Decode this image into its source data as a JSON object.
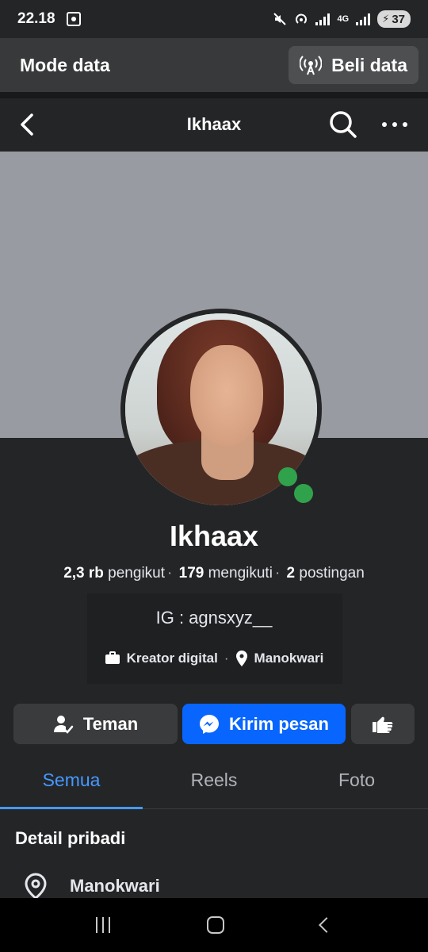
{
  "status_bar": {
    "time": "22.18",
    "network": "4G",
    "battery": "37"
  },
  "data_banner": {
    "title": "Mode data",
    "buy_label": "Beli data"
  },
  "header": {
    "title": "Ikhaax"
  },
  "profile": {
    "name": "Ikhaax",
    "followers_count": "2,3 rb",
    "followers_label": "pengikut",
    "following_count": "179",
    "following_label": "mengikuti",
    "posts_count": "2",
    "posts_label": "postingan",
    "bio": "IG : agnsxyz__",
    "category": "Kreator digital",
    "location": "Manokwari",
    "online": true
  },
  "actions": {
    "friend_label": "Teman",
    "message_label": "Kirim pesan"
  },
  "tabs": [
    {
      "label": "Semua",
      "active": true
    },
    {
      "label": "Reels",
      "active": false
    },
    {
      "label": "Foto",
      "active": false
    }
  ],
  "details": {
    "title": "Detail pribadi",
    "location": "Manokwari"
  },
  "colors": {
    "accent": "#0866ff",
    "tab_active": "#4599ff",
    "online": "#31a24c",
    "background": "#242527"
  },
  "icons": [
    "screenshot-icon",
    "mute-icon",
    "hotspot-icon",
    "signal-icon",
    "battery-icon",
    "antenna-icon",
    "back-icon",
    "search-icon",
    "more-icon",
    "briefcase-icon",
    "location-pin-icon",
    "friend-check-icon",
    "messenger-icon",
    "hand-point-icon"
  ]
}
